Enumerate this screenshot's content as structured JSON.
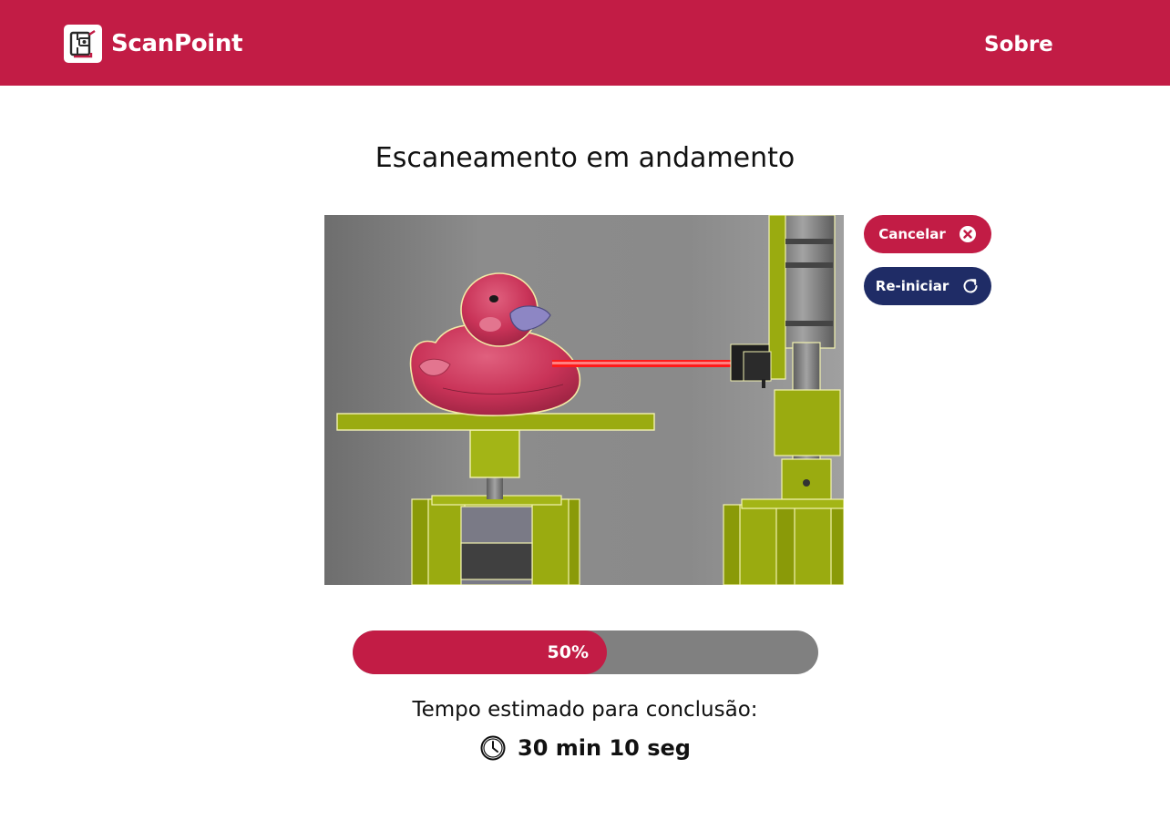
{
  "app": {
    "name": "ScanPoint",
    "logo_icon": "scanner-logo-icon",
    "brand_color": "#c21c45",
    "secondary_color": "#1f2c66"
  },
  "nav": {
    "about_label": "Sobre"
  },
  "main": {
    "title": "Escaneamento em andamento",
    "preview": {
      "description_icon": "scan-preview-image"
    },
    "actions": {
      "cancel_label": "Cancelar",
      "cancel_icon": "close-circle-icon",
      "restart_label": "Re-iniciar",
      "restart_icon": "refresh-icon"
    },
    "progress": {
      "value": 0.5,
      "label": "50%"
    },
    "eta": {
      "label": "Tempo estimado para conclusão:",
      "value": "30 min 10 seg",
      "icon": "clock-icon"
    }
  }
}
